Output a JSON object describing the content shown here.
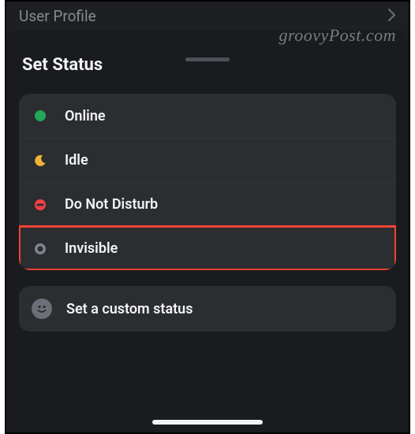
{
  "header": {
    "back_label": "User Profile"
  },
  "sheet": {
    "title": "Set Status"
  },
  "statuses": [
    {
      "id": "online",
      "label": "Online",
      "color": "#23a55a"
    },
    {
      "id": "idle",
      "label": "Idle",
      "color": "#f0b232"
    },
    {
      "id": "dnd",
      "label": "Do Not Disturb",
      "color": "#f23f43"
    },
    {
      "id": "invisible",
      "label": "Invisible",
      "color": "#80848e"
    }
  ],
  "custom_status": {
    "label": "Set a custom status"
  },
  "watermark": "groovyPost.com"
}
